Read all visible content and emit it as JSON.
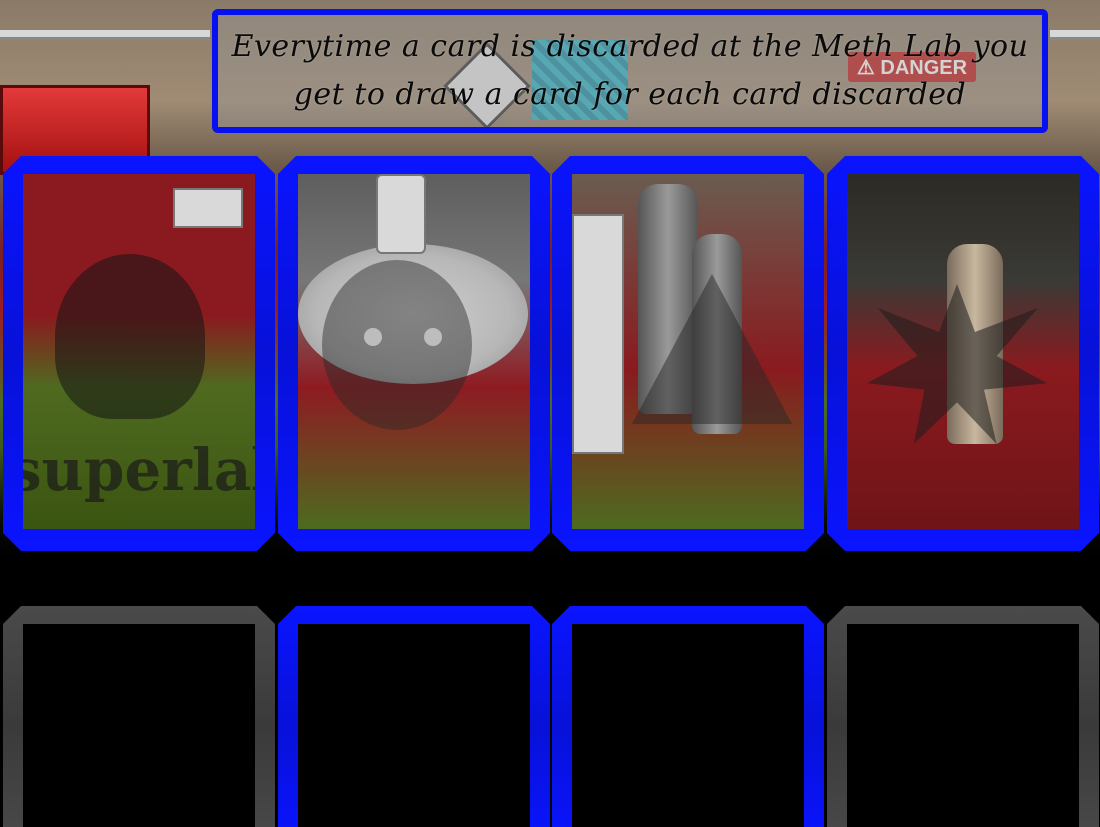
{
  "banner": {
    "line1": "Everytime a card is discarded at the Meth Lab you",
    "line2": "get to draw a card for each card discarded"
  },
  "scene": {
    "danger_sign": "⚠ DANGER"
  },
  "cards_row1": [
    {
      "watermark": "superlab",
      "border_color": "#0a14ff"
    },
    {
      "border_color": "#0a14ff"
    },
    {
      "border_color": "#0a14ff"
    },
    {
      "border_color": "#0a14ff"
    }
  ],
  "slots_row2": [
    {
      "border_color": "#444444",
      "state": "empty"
    },
    {
      "border_color": "#0a14ff",
      "state": "empty"
    },
    {
      "border_color": "#0a14ff",
      "state": "empty"
    },
    {
      "border_color": "#444444",
      "state": "empty"
    }
  ],
  "colors": {
    "highlight_border": "#0a14ff",
    "inactive_border": "#444444",
    "background": "#000000"
  }
}
